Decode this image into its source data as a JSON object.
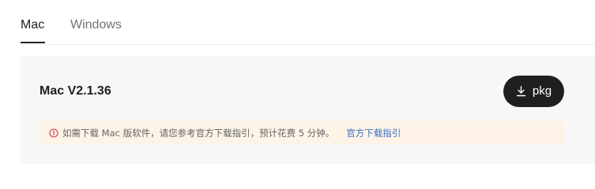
{
  "tabs": [
    {
      "label": "Mac",
      "active": true
    },
    {
      "label": "Windows",
      "active": false
    }
  ],
  "download": {
    "version": "Mac V2.1.36",
    "button_label": "pkg",
    "button_icon": "download-icon"
  },
  "notice": {
    "icon": "warning-circle-icon",
    "text": "如需下载 Mac 版软件，请您参考官方下载指引，预计花费 5 分钟。",
    "link_text": "官方下载指引"
  },
  "colors": {
    "accent_dark": "#1f1f1f",
    "notice_bg": "#fdf3e7",
    "warning": "#d9363e",
    "link": "#3b6fc4"
  }
}
